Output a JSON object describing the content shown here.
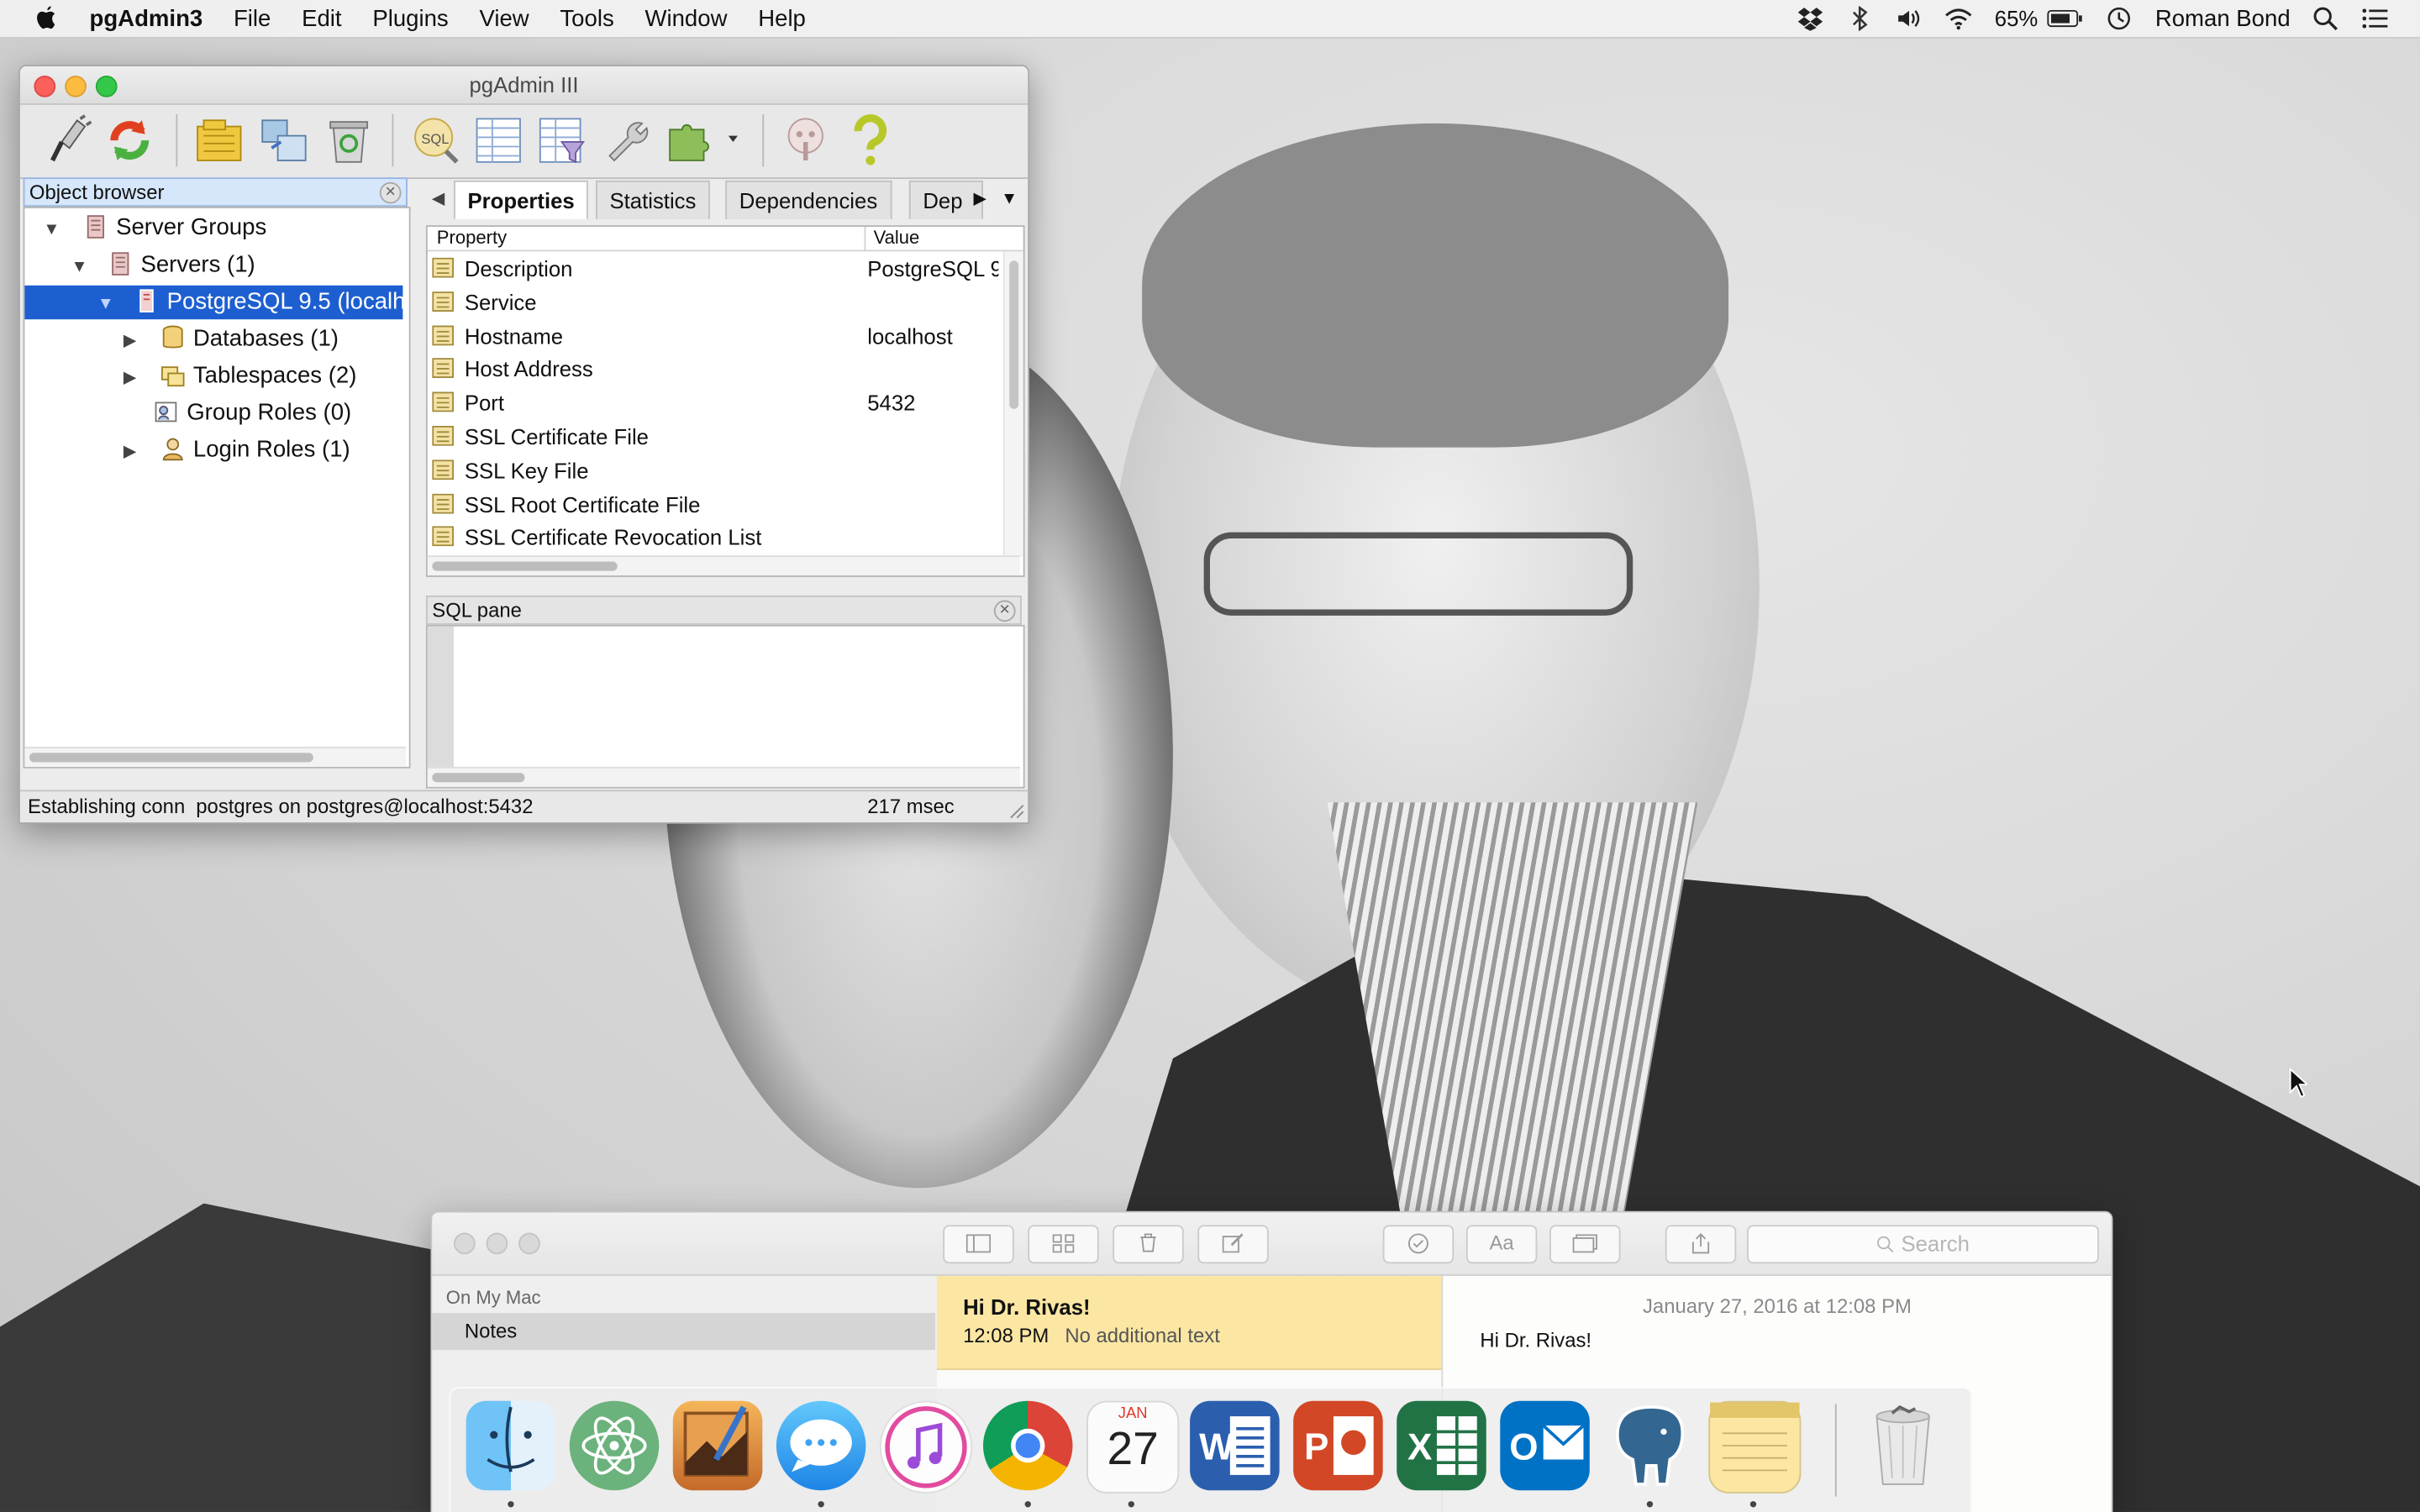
{
  "menubar": {
    "app_name": "pgAdmin3",
    "items": [
      "File",
      "Edit",
      "Plugins",
      "View",
      "Tools",
      "Window",
      "Help"
    ],
    "battery": "65%",
    "user": "Roman Bond"
  },
  "pgadmin": {
    "window_title": "pgAdmin III",
    "object_browser_title": "Object browser",
    "tree": [
      {
        "label": "Server Groups",
        "expanded": true
      },
      {
        "label": "Servers (1)",
        "expanded": true
      },
      {
        "label": "PostgreSQL 9.5 (localh",
        "selected": true
      },
      {
        "label": "Databases (1)"
      },
      {
        "label": "Tablespaces (2)"
      },
      {
        "label": "Group Roles (0)"
      },
      {
        "label": "Login Roles (1)"
      }
    ],
    "tabs": [
      "Properties",
      "Statistics",
      "Dependencies",
      "Dep"
    ],
    "active_tab": "Properties",
    "columns": {
      "property": "Property",
      "value": "Value"
    },
    "properties": [
      {
        "name": "Description",
        "value": "PostgreSQL 9"
      },
      {
        "name": "Service",
        "value": ""
      },
      {
        "name": "Hostname",
        "value": "localhost"
      },
      {
        "name": "Host Address",
        "value": ""
      },
      {
        "name": "Port",
        "value": "5432"
      },
      {
        "name": "SSL Certificate File",
        "value": ""
      },
      {
        "name": "SSL Key File",
        "value": ""
      },
      {
        "name": "SSL Root Certificate File",
        "value": ""
      },
      {
        "name": "SSL Certificate Revocation List",
        "value": ""
      }
    ],
    "sql_pane_title": "SQL pane",
    "status": {
      "message": "Establishing conn",
      "connection": "postgres on postgres@localhost:5432",
      "timing": "217 msec"
    }
  },
  "notes": {
    "search_placeholder": "Search",
    "sidebar_header": "On My Mac",
    "sidebar_item": "Notes",
    "note_title": "Hi Dr. Rivas!",
    "note_time": "12:08 PM",
    "note_preview": "No additional text",
    "editor_date": "January 27, 2016 at 12:08 PM",
    "editor_text": "Hi Dr. Rivas!",
    "format_button": "Aa"
  },
  "dock": {
    "apps": [
      "Finder",
      "Atom",
      "Pixelmator",
      "Messages",
      "iTunes",
      "Google Chrome",
      "Calendar",
      "Microsoft Word",
      "Microsoft PowerPoint",
      "Microsoft Excel",
      "Microsoft Outlook",
      "pgAdmin3",
      "Notes"
    ],
    "calendar_month": "JAN",
    "calendar_day": "27",
    "trash": "Trash"
  }
}
